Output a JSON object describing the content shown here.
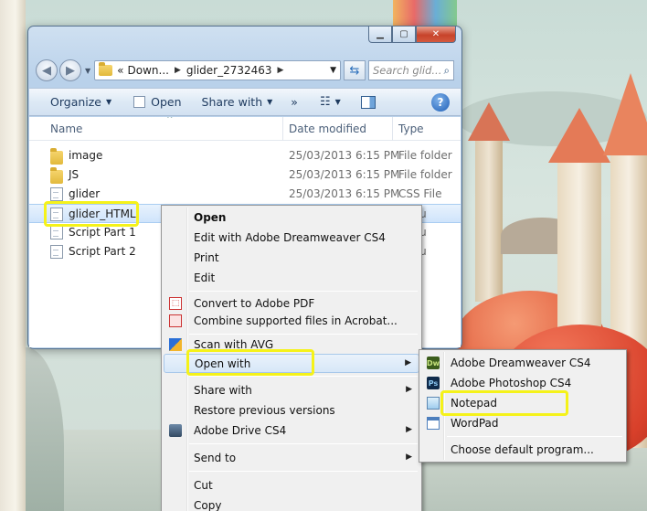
{
  "explorer": {
    "breadcrumb": {
      "root": "«",
      "parent": "Down...",
      "current": "glider_2732463"
    },
    "search_placeholder": "Search glid...",
    "toolbar": {
      "organize": "Organize",
      "open": "Open",
      "share_with": "Share with",
      "more": "»"
    },
    "columns": {
      "name": "Name",
      "date_modified": "Date modified",
      "type": "Type"
    },
    "files": [
      {
        "name": "image",
        "date": "25/03/2013 6:15 PM",
        "type": "File folder",
        "icon": "folder-icon"
      },
      {
        "name": "JS",
        "date": "25/03/2013 6:15 PM",
        "type": "File folder",
        "icon": "folder-icon"
      },
      {
        "name": "glider",
        "date": "25/03/2013 6:15 PM",
        "type": "CSS File",
        "icon": "document-icon"
      },
      {
        "name": "glider_HTML",
        "date": "",
        "type": "Docu",
        "icon": "document-icon",
        "selected": true
      },
      {
        "name": "Script Part 1",
        "date": "",
        "type": "Docu",
        "icon": "document-icon"
      },
      {
        "name": "Script Part 2",
        "date": "",
        "type": "Docu",
        "icon": "document-icon"
      }
    ]
  },
  "context_menu": {
    "items": [
      {
        "label": "Open",
        "bold": true
      },
      {
        "label": "Edit with Adobe Dreamweaver CS4"
      },
      {
        "label": "Print"
      },
      {
        "label": "Edit"
      },
      {
        "label": "Convert to Adobe PDF",
        "icon": "adobe-pdf-icon"
      },
      {
        "label": "Combine supported files in Acrobat...",
        "icon": "acrobat-combine-icon"
      },
      {
        "label": "Scan with AVG",
        "icon": "avg-icon"
      },
      {
        "label": "Open with",
        "has_submenu": true,
        "active": true
      },
      {
        "label": "Share with",
        "has_submenu": true
      },
      {
        "label": "Restore previous versions"
      },
      {
        "label": "Adobe Drive CS4",
        "icon": "adobe-drive-icon",
        "has_submenu": true
      },
      {
        "label": "Send to",
        "has_submenu": true
      },
      {
        "label": "Cut"
      },
      {
        "label": "Copy"
      }
    ]
  },
  "open_with_submenu": {
    "items": [
      {
        "label": "Adobe Dreamweaver CS4",
        "icon": "dreamweaver-icon",
        "badge": "Dw"
      },
      {
        "label": "Adobe Photoshop CS4",
        "icon": "photoshop-icon",
        "badge": "Ps"
      },
      {
        "label": "Notepad",
        "icon": "notepad-icon",
        "highlighted": true
      },
      {
        "label": "WordPad",
        "icon": "wordpad-icon"
      },
      {
        "label": "Choose default program..."
      }
    ]
  },
  "colors": {
    "highlight": "#f5f21a",
    "selection": "#cfe4fb",
    "window_chrome": "#b9d1ea"
  }
}
